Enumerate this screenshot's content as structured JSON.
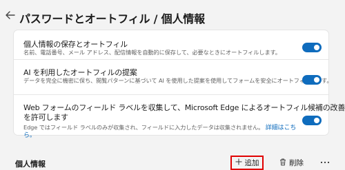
{
  "header": {
    "back_icon": "back-arrow-icon",
    "title": "パスワードとオートフィル / 個人情報"
  },
  "settings": [
    {
      "title": "個人情報の保存とオートフィル",
      "description": "名前、電話番号、メール アドレス、配信情報を自動的に保存して、必要なときにオートフィルします。",
      "enabled": true
    },
    {
      "title": "AI を利用したオートフィルの提案",
      "description": "データを完全に機密に保ち、閲覧パターンに基づいて AI を使用した提案を使用してフォームを安全にオートフィルします。",
      "enabled": true
    },
    {
      "title_line1": "Web フォームのフィールド ラベルを収集して、Microsoft Edge によるオートフィル候補の改善",
      "title_line2": "を許可します",
      "description": "Edge ではフィールド ラベルのみが収集され、フィールドに入力したデータは収集されません。",
      "link_line1": "詳細はこち",
      "link_line2": "ら。",
      "enabled": true
    }
  ],
  "section": {
    "title": "個人情報",
    "add_label": "追加",
    "delete_label": "削除",
    "add_icon": "plus-icon",
    "delete_icon": "trash-icon",
    "more_icon": "more-icon"
  },
  "colors": {
    "accent": "#0f6cbd",
    "highlight": "#e00000"
  }
}
